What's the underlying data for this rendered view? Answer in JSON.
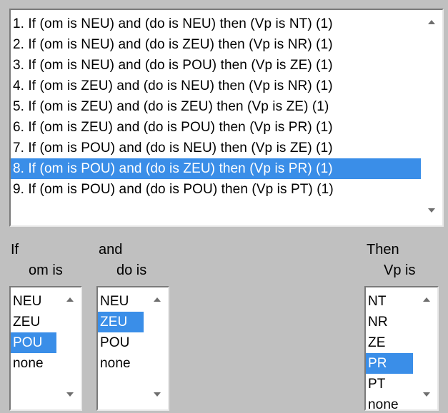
{
  "rules": {
    "items": [
      "1. If (om is NEU) and (do is NEU) then (Vp is NT) (1)",
      "2. If (om is NEU) and (do is ZEU) then (Vp is NR) (1)",
      "3. If (om is NEU) and (do is POU) then (Vp is ZE) (1)",
      "4. If (om is ZEU) and (do is NEU) then (Vp is NR) (1)",
      "5. If (om is ZEU) and (do is ZEU) then (Vp is ZE) (1)",
      "6. If (om is ZEU) and (do is POU) then (Vp is PR) (1)",
      "7. If (om is POU) and (do is NEU) then (Vp is ZE) (1)",
      "8. If (om is POU) and (do is ZEU) then (Vp is PR) (1)",
      "9. If (om is POU) and (do is POU) then (Vp is PT) (1)"
    ],
    "selected_index": 7
  },
  "if_section": {
    "keyword": "If",
    "variable_label": "om is",
    "options": [
      "NEU",
      "ZEU",
      "POU",
      "none"
    ],
    "selected_index": 2
  },
  "and_section": {
    "keyword": "and",
    "variable_label": "do is",
    "options": [
      "NEU",
      "ZEU",
      "POU",
      "none"
    ],
    "selected_index": 1
  },
  "then_section": {
    "keyword": "Then",
    "variable_label": "Vp is",
    "options": [
      "NT",
      "NR",
      "ZE",
      "PR",
      "PT",
      "none"
    ],
    "selected_index": 3
  },
  "colors": {
    "window_bg": "#c0c0c0",
    "selection": "#3a8ee8"
  },
  "icons": [
    "scroll-up-arrow-icon",
    "scroll-down-arrow-icon"
  ]
}
